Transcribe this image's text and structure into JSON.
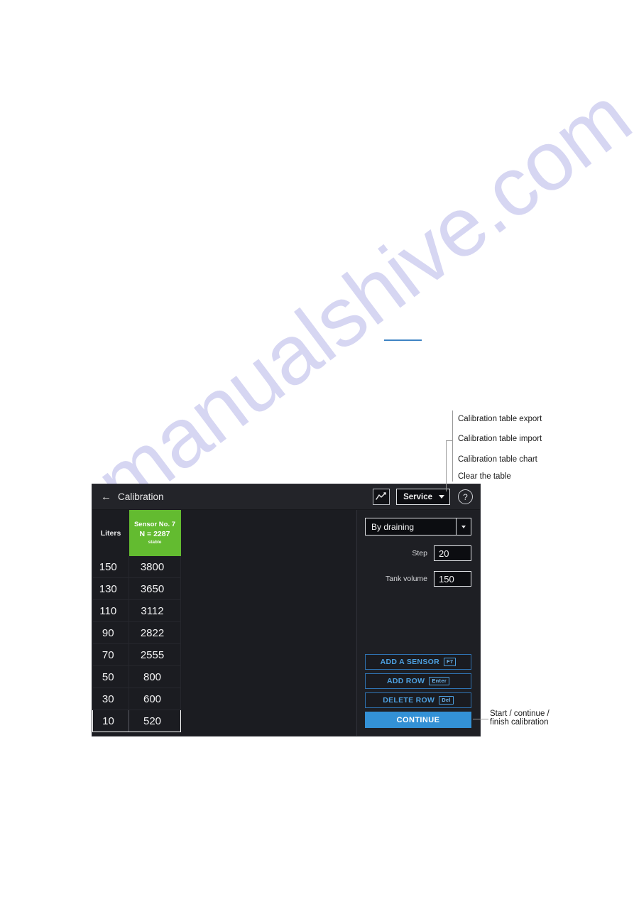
{
  "watermark": {
    "text": "manualshive.com"
  },
  "window": {
    "header": {
      "back_icon": "back-arrow-icon",
      "title": "Calibration",
      "chart_icon": "line-chart-icon",
      "service_label": "Service",
      "help_icon": "question-mark-icon"
    },
    "table": {
      "liters_header": "Liters",
      "sensor_header": {
        "name": "Sensor No. 7",
        "n_value": "N = 2287",
        "status": "stable"
      },
      "rows": [
        {
          "liters": "150",
          "sensor": "3800"
        },
        {
          "liters": "130",
          "sensor": "3650"
        },
        {
          "liters": "110",
          "sensor": "3112"
        },
        {
          "liters": "90",
          "sensor": "2822"
        },
        {
          "liters": "70",
          "sensor": "2555"
        },
        {
          "liters": "50",
          "sensor": "800"
        },
        {
          "liters": "30",
          "sensor": "600"
        },
        {
          "liters": "10",
          "sensor": "520"
        }
      ],
      "selected_row_index": 7
    },
    "controls": {
      "mode_value": "By draining",
      "mode_options": [
        "By draining"
      ],
      "step_label": "Step",
      "step_value": "20",
      "tank_volume_label": "Tank volume",
      "tank_volume_value": "150",
      "buttons": [
        {
          "label": "ADD A SENSOR",
          "key": "F7"
        },
        {
          "label": "ADD ROW",
          "key": "Enter"
        },
        {
          "label": "DELETE ROW",
          "key": "Del"
        }
      ],
      "continue_label": "CONTINUE"
    }
  },
  "annotations": {
    "service_menu": [
      "Calibration table export",
      "Calibration table import",
      "Calibration table chart",
      "Clear the table"
    ],
    "continue_note_line1": "Start / continue /",
    "continue_note_line2": "finish calibration"
  },
  "colors": {
    "accent_blue": "#3391d6",
    "sensor_green": "#63bb30",
    "panel_bg": "#1e1f24",
    "table_bg": "#1b1c21"
  }
}
